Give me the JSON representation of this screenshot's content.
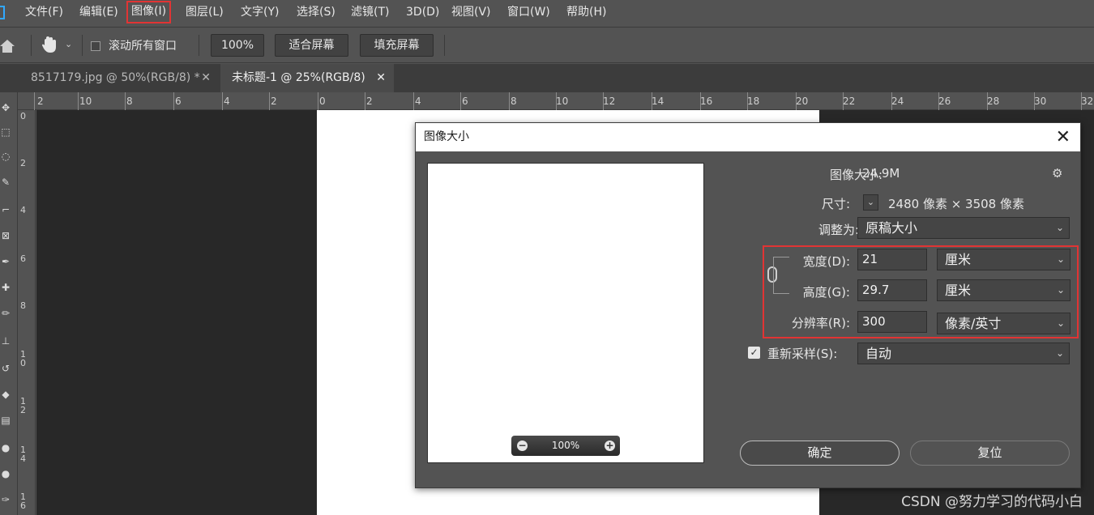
{
  "menu": [
    "文件(F)",
    "编辑(E)",
    "图像(I)",
    "图层(L)",
    "文字(Y)",
    "选择(S)",
    "滤镜(T)",
    "3D(D)",
    "视图(V)",
    "窗口(W)",
    "帮助(H)"
  ],
  "options": {
    "scroll_all_label": "滚动所有窗口",
    "zoom": "100%",
    "fit_screen": "适合屏幕",
    "fill_screen": "填充屏幕"
  },
  "tabs": [
    {
      "label": "8517179.jpg @ 50%(RGB/8) *",
      "close": "✕"
    },
    {
      "label": "未标题-1 @ 25%(RGB/8)",
      "close": "✕"
    }
  ],
  "ruler_h": [
    "2",
    "10",
    "8",
    "6",
    "4",
    "2",
    "0",
    "2",
    "4",
    "6",
    "8",
    "10",
    "12",
    "14",
    "16",
    "18",
    "20",
    "22",
    "24",
    "26",
    "28",
    "30",
    "32"
  ],
  "ruler_v": [
    "0",
    "2",
    "4",
    "6",
    "8",
    "10",
    "12",
    "14",
    "16"
  ],
  "dialog": {
    "title": "图像大小",
    "close": "✕",
    "image_size_label": "图像大小:",
    "image_size_value": "24.9M",
    "dimensions_label": "尺寸:",
    "dimensions_value": "2480 像素  ×  3508 像素",
    "fit_to_label": "调整为:",
    "fit_to_value": "原稿大小",
    "width_label": "宽度(D):",
    "width_value": "21",
    "width_unit": "厘米",
    "height_label": "高度(G):",
    "height_value": "29.7",
    "height_unit": "厘米",
    "resolution_label": "分辨率(R):",
    "resolution_value": "300",
    "resolution_unit": "像素/英寸",
    "resample_label": "重新采样(S):",
    "resample_value": "自动",
    "zoom_value": "100%",
    "ok_button": "确定",
    "reset_button": "复位"
  },
  "watermark": "CSDN @努力学习的代码小白",
  "colors": {
    "highlight": "#e13434",
    "ps_blue": "#31a8ff"
  }
}
